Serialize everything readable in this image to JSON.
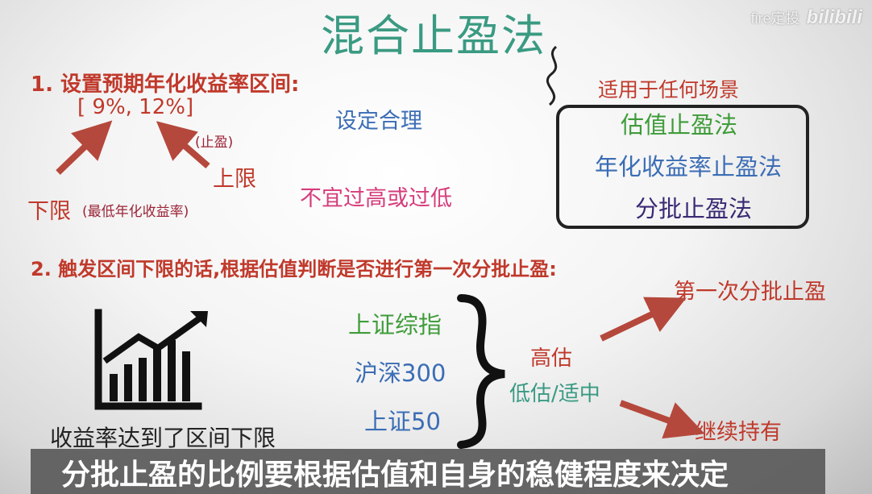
{
  "watermark": {
    "text": "fire定投",
    "logo": "bilibili"
  },
  "title": "混合止盈法",
  "step1": {
    "heading": "1.  设置预期年化收益率区间:",
    "range": "[ 9%,   12%]",
    "upper_note": "(止盈)",
    "upper_label": "上限",
    "lower_label": "下限",
    "lower_note": "(最低年化收益率)",
    "reasonable": "设定合理",
    "warning": "不宜过高或过低"
  },
  "methods": {
    "title": "适用于任何场景",
    "items": [
      "估值止盈法",
      "年化收益率止盈法",
      "分批止盈法"
    ]
  },
  "step2": {
    "heading": "2.  触发区间下限的话,根据估值判断是否进行第一次分批止盈:",
    "indices": [
      "上证综指",
      "沪深300",
      "上证50"
    ],
    "high": "高估",
    "low": "低估/适中",
    "first_batch": "第一次分批止盈",
    "keep_holding": "继续持有",
    "reach_lower": "收益率达到了区间下限"
  },
  "subtitle": "分批止盈的比例要根据估值和自身的稳健程度来决定",
  "colors": {
    "title": "#3a9a82",
    "red": "#c0392b",
    "green": "#3f9c3a",
    "blue": "#3b6db5",
    "pink": "#d63d7c",
    "arrow": "#b5483c"
  }
}
